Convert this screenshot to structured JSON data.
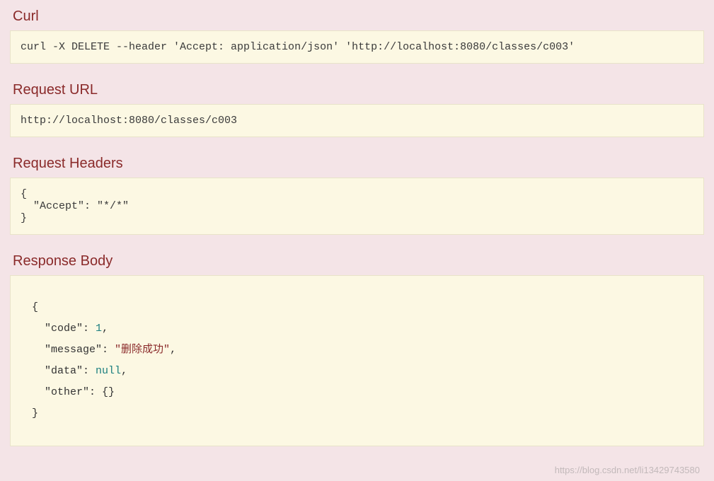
{
  "sections": {
    "curl": {
      "title": "Curl",
      "command": "curl -X DELETE --header 'Accept: application/json' 'http://localhost:8080/classes/c003'"
    },
    "request_url": {
      "title": "Request URL",
      "value": "http://localhost:8080/classes/c003"
    },
    "request_headers": {
      "title": "Request Headers",
      "headers": {
        "Accept": "*/*"
      }
    },
    "response_body": {
      "title": "Response Body",
      "body": {
        "code": 1,
        "message": "删除成功",
        "data": null,
        "other": {}
      }
    }
  },
  "watermark": "https://blog.csdn.net/li13429743580"
}
